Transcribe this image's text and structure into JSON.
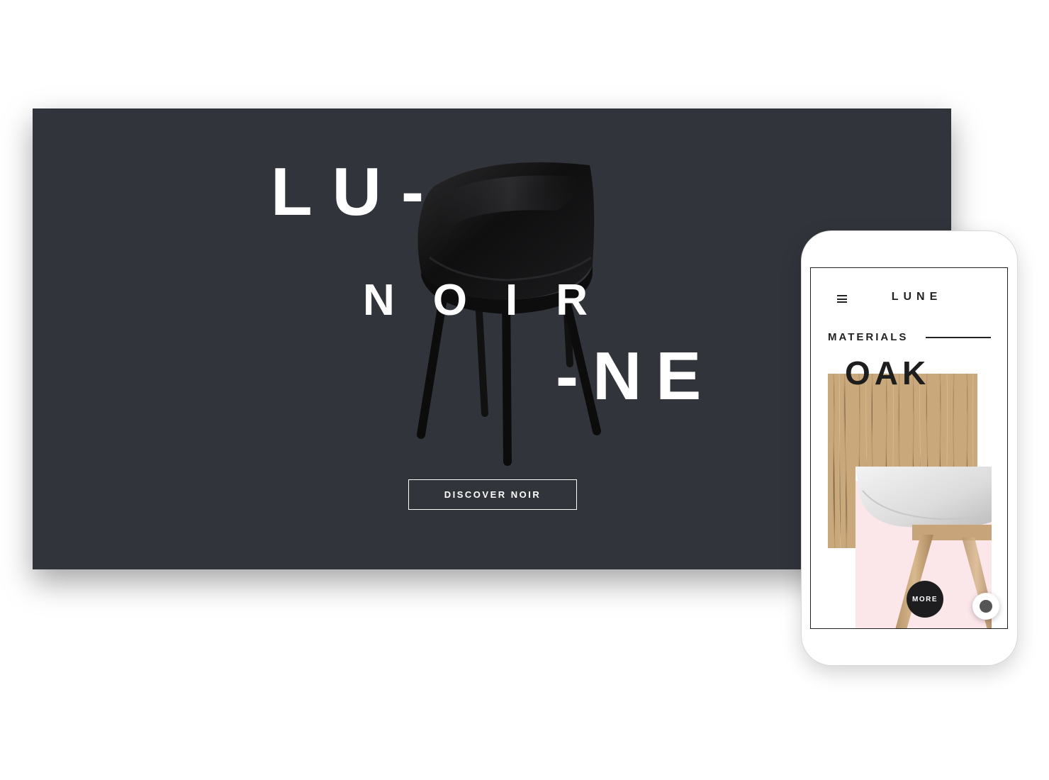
{
  "desktop": {
    "word_lu": "LU-",
    "word_noir": "NOIR",
    "word_ne": "-NE",
    "cta_label": "DISCOVER NOIR"
  },
  "mobile": {
    "brand": "LUNE",
    "section_label": "MATERIALS",
    "material_title": "OAK",
    "more_label": "MORE"
  },
  "colors": {
    "desktop_bg": "#31343b",
    "text_light": "#ffffff",
    "text_dark": "#222222",
    "wood": "#c8a679",
    "pink": "#fbe6ea"
  },
  "icons": [
    "menu-icon",
    "chair-image",
    "oak-wood-texture",
    "home-button-icon"
  ]
}
